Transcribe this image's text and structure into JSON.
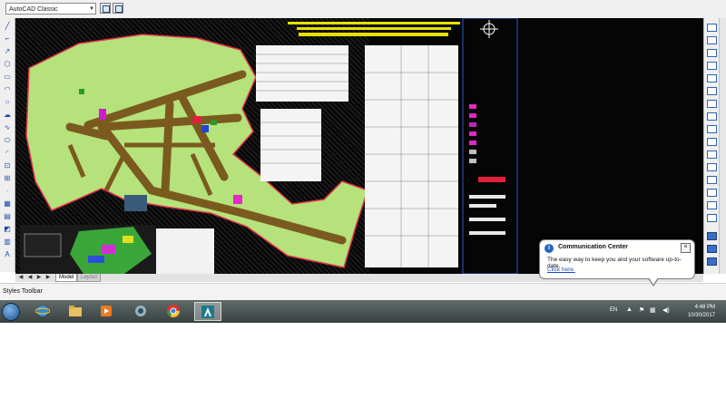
{
  "workspace": {
    "current": "AutoCAD Classic"
  },
  "drawing_tabs": [
    "Model",
    "Layout"
  ],
  "statusbar": {
    "label": "Styles Toolbar"
  },
  "notification": {
    "title": "Communication Center",
    "message": "The easy way to keep you and your software up-to-date.",
    "link": "Click here."
  },
  "clock": {
    "time": "4:48 PM",
    "date": "10/30/2017"
  },
  "tray": {
    "language": "EN"
  },
  "colors": {
    "map_green": "#b5e27a",
    "road_brown": "#7a5a1f",
    "canvas": "#050505"
  },
  "icons": {
    "left_toolbar": [
      "line-icon",
      "polyline-icon",
      "construction-line-icon",
      "polygon-icon",
      "rectangle-icon",
      "arc-icon",
      "circle-icon",
      "revision-cloud-icon",
      "spline-icon",
      "ellipse-icon",
      "ellipse-arc-icon",
      "insert-block-icon",
      "make-block-icon",
      "point-icon",
      "hatch-icon",
      "gradient-icon",
      "region-icon",
      "table-icon",
      "multiline-text-icon"
    ],
    "right_toolbar": [
      "erase-icon",
      "copy-icon",
      "mirror-icon",
      "offset-icon",
      "array-icon",
      "move-icon",
      "rotate-icon",
      "scale-icon",
      "stretch-icon",
      "trim-icon",
      "extend-icon",
      "break-icon",
      "join-icon",
      "chamfer-icon",
      "fillet-icon",
      "explode-icon"
    ]
  }
}
